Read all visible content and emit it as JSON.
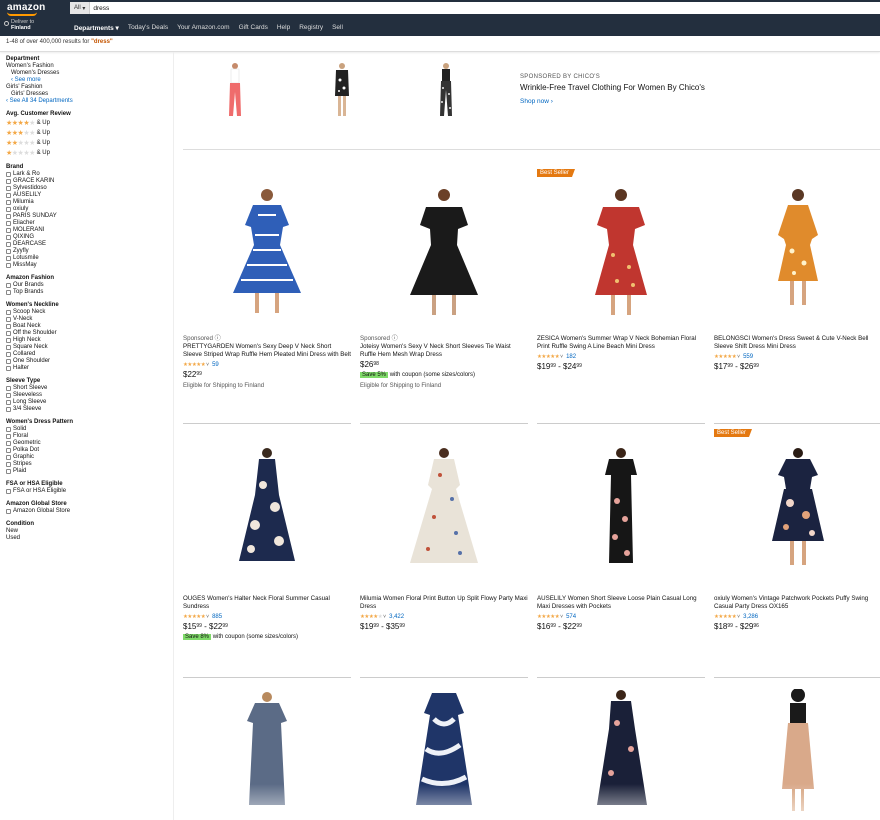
{
  "header": {
    "logo_text": "amazon",
    "search_category": "All",
    "search_value": "dress",
    "deliver_line1": "Deliver to",
    "deliver_line2": "Finland",
    "nav": [
      "Departments",
      "Today's Deals",
      "Your Amazon.com",
      "Gift Cards",
      "Help",
      "Registry",
      "Sell"
    ]
  },
  "results": {
    "prefix": "1-48 of over 400,000 results for ",
    "query": "\"dress\""
  },
  "sidebar": {
    "department_head": "Department",
    "department_items": [
      "Women's Fashion",
      "Women's Dresses"
    ],
    "see_more": "‹ See more",
    "girls_items": [
      "Girls' Fashion",
      "Girls' Dresses"
    ],
    "see_all": "‹ See All 34 Departments",
    "review_head": "Avg. Customer Review",
    "review_items": [
      "& Up",
      "& Up",
      "& Up",
      "& Up"
    ],
    "brand_head": "Brand",
    "brands": [
      "Lark & Ro",
      "GRACE KARIN",
      "Sylvestidoso",
      "AUSELILY",
      "Milumia",
      "oxiuly",
      "PARIS SUNDAY",
      "Eliacher",
      "MOLERANI",
      "QIXING",
      "DEARCASE",
      "Zyyfly",
      "Lotusmile",
      "MissMay"
    ],
    "fashion_head": "Amazon Fashion",
    "fashion_items": [
      "Our Brands",
      "Top Brands"
    ],
    "neckline_head": "Women's Neckline",
    "necklines": [
      "Scoop Neck",
      "V-Neck",
      "Boat Neck",
      "Off the Shoulder",
      "High Neck",
      "Square Neck",
      "Collared",
      "One Shoulder",
      "Halter"
    ],
    "sleeve_head": "Sleeve Type",
    "sleeves": [
      "Short Sleeve",
      "Sleeveless",
      "Long Sleeve",
      "3/4 Sleeve"
    ],
    "pattern_head": "Women's Dress Pattern",
    "patterns": [
      "Solid",
      "Floral",
      "Geometric",
      "Polka Dot",
      "Graphic",
      "Stripes",
      "Plaid"
    ],
    "fsa_head": "FSA or HSA Eligible",
    "fsa_items": [
      "FSA or HSA Eligible"
    ],
    "global_head": "Amazon Global Store",
    "global_items": [
      "Amazon Global Store"
    ],
    "condition_head": "Condition",
    "condition_items": [
      "New",
      "Used"
    ]
  },
  "sponsored_banner": {
    "label": "SPONSORED BY CHICO'S",
    "title": "Wrinkle-Free Travel Clothing For Women By Chico's",
    "shop": "Shop now ›"
  },
  "products": [
    {
      "badge": "",
      "sponsored": "Sponsored",
      "title": "PRETTYGARDEN Women's Sexy Deep V Neck Short Sleeve Striped Wrap Ruffle Hem Pleated Mini Dress with Belt",
      "rating": 4.5,
      "count": "59",
      "price": "$22",
      "price_cents": "99",
      "price2": "",
      "price2_cents": "",
      "save": "",
      "coupon": "",
      "ship": "Eligible for Shipping to Finland"
    },
    {
      "badge": "",
      "sponsored": "Sponsored",
      "title": "Joteisy Women's Sexy V Neck Short Sleeves Tie Waist Ruffle Hem Mesh Wrap Dress",
      "rating": 0,
      "count": "",
      "price": "$26",
      "price_cents": "98",
      "price2": "",
      "price2_cents": "",
      "save": "Save 5%",
      "coupon": "with coupon (some sizes/colors)",
      "ship": "Eligible for Shipping to Finland"
    },
    {
      "badge": "Best Seller",
      "sponsored": "",
      "title": "ZESICA Women's Summer Wrap V Neck Bohemian Floral Print Ruffle Swing A Line Beach Mini Dress",
      "rating": 4.5,
      "count": "182",
      "price": "$19",
      "price_cents": "99",
      "price2": "$24",
      "price2_cents": "99",
      "save": "",
      "coupon": "",
      "ship": ""
    },
    {
      "badge": "",
      "sponsored": "",
      "title": "BELONGSCI Women's Dress Sweet & Cute V-Neck Bell Sleeve Shift Dress Mini Dress",
      "rating": 4.5,
      "count": "559",
      "price": "$17",
      "price_cents": "99",
      "price2": "$26",
      "price2_cents": "99",
      "save": "",
      "coupon": "",
      "ship": ""
    },
    {
      "badge": "",
      "sponsored": "",
      "title": "OUGES Women's Halter Neck Floral Summer Casual Sundress",
      "rating": 4.5,
      "count": "885",
      "price": "$15",
      "price_cents": "99",
      "price2": "$22",
      "price2_cents": "99",
      "save": "Save 8%",
      "coupon": "with coupon (some sizes/colors)",
      "ship": ""
    },
    {
      "badge": "",
      "sponsored": "",
      "title": "Milumia Women Floral Print Button Up Split Flowy Party Maxi Dress",
      "rating": 4.0,
      "count": "3,422",
      "price": "$19",
      "price_cents": "99",
      "price2": "$35",
      "price2_cents": "99",
      "save": "",
      "coupon": "",
      "ship": ""
    },
    {
      "badge": "",
      "sponsored": "",
      "title": "AUSELILY Women Short Sleeve Loose Plain Casual Long Maxi Dresses with Pockets",
      "rating": 4.5,
      "count": "574",
      "price": "$16",
      "price_cents": "99",
      "price2": "$22",
      "price2_cents": "99",
      "save": "",
      "coupon": "",
      "ship": ""
    },
    {
      "badge": "Best Seller",
      "sponsored": "",
      "title": "oxiuly Women's Vintage Patchwork Pockets Puffy Swing Casual Party Dress OX165",
      "rating": 4.5,
      "count": "3,286",
      "price": "$18",
      "price_cents": "99",
      "price2": "$29",
      "price2_cents": "96",
      "save": "",
      "coupon": "",
      "ship": ""
    }
  ],
  "colors": {
    "header_bg": "#232f3e",
    "accent": "#f90",
    "badge": "#e47911",
    "link": "#0066c0",
    "star": "#f3a847"
  }
}
